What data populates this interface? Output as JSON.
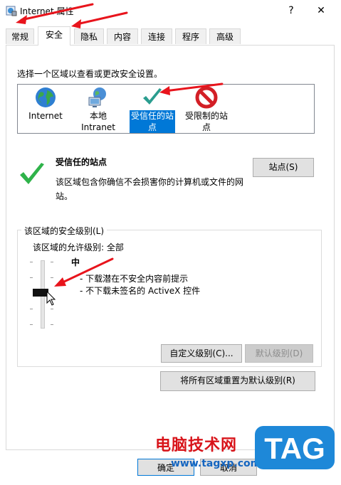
{
  "window": {
    "title": "Internet 属性",
    "help_label": "?",
    "close_label": "✕"
  },
  "tabs": [
    {
      "label": "常规"
    },
    {
      "label": "安全"
    },
    {
      "label": "隐私"
    },
    {
      "label": "内容"
    },
    {
      "label": "连接"
    },
    {
      "label": "程序"
    },
    {
      "label": "高级"
    }
  ],
  "active_tab": "安全",
  "security": {
    "zone_prompt": "选择一个区域以查看或更改安全设置。",
    "zones": [
      {
        "label_line1": "Internet",
        "label_line2": "",
        "icon": "globe-icon"
      },
      {
        "label_line1": "本地",
        "label_line2": "Intranet",
        "icon": "network-icon"
      },
      {
        "label_line1": "受信任的站",
        "label_line2": "点",
        "icon": "checkmark-icon"
      },
      {
        "label_line1": "受限制的站",
        "label_line2": "点",
        "icon": "restricted-icon"
      }
    ],
    "selected_zone": "受信任的站点",
    "site_title": "受信任的站点",
    "site_description": "该区域包含你确信不会损害你的计算机或文件的网站。",
    "sites_button": "站点(S)",
    "group_label": "该区域的安全级别(L)",
    "allowed_label": "该区域的允许级别: 全部",
    "level_name": "中",
    "level_items": [
      "- 下载潜在不安全内容前提示",
      "- 不下载未签名的 ActiveX 控件"
    ],
    "slider_level_fraction": 0.6,
    "custom_level_button": "自定义级别(C)...",
    "default_level_button": "默认级别(D)",
    "reset_all_button": "将所有区域重置为默认级别(R)"
  },
  "dialog_buttons": {
    "ok": "确定",
    "cancel": "取消"
  },
  "watermark": {
    "text": "电脑技术网",
    "url": "www.tagxp.com",
    "logo_text": "TAG"
  },
  "colors": {
    "selection": "#0078d7",
    "annotation_arrow": "#e8141c",
    "check_green": "#2fb34a"
  }
}
